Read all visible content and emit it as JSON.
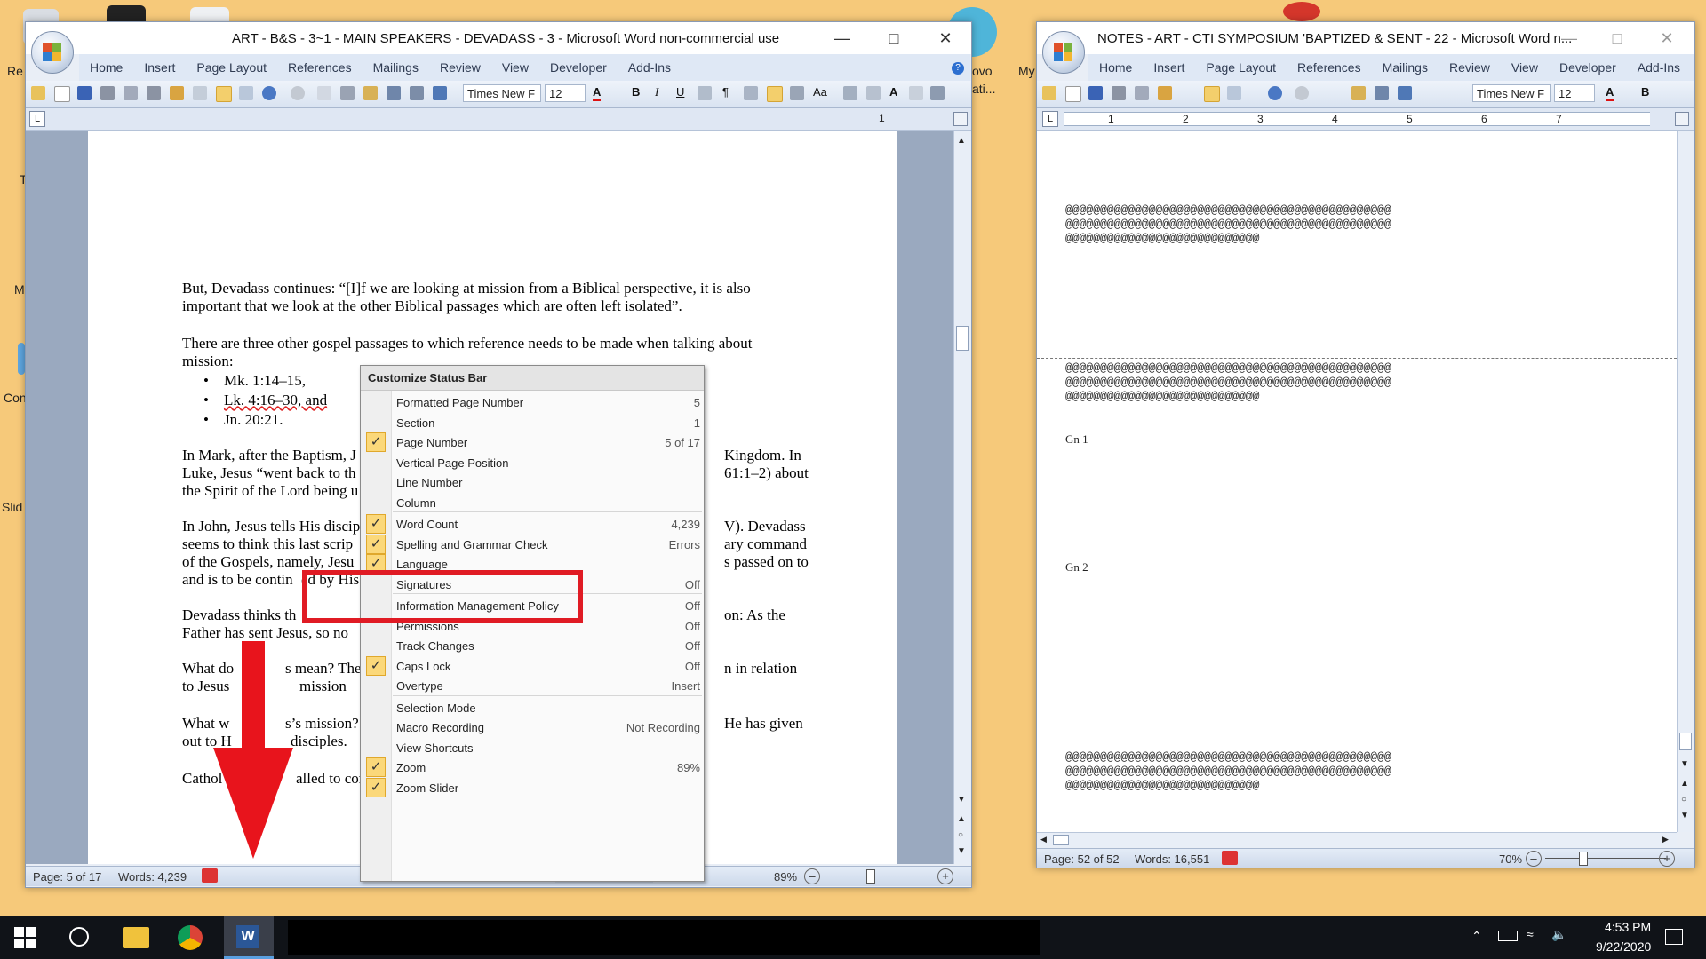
{
  "desktop": {
    "labels": [
      "Re",
      "My",
      "M",
      "Con",
      "Slid",
      "ovo",
      "ati...",
      "T"
    ]
  },
  "left_window": {
    "title": "ART - B&S - 3~1 - MAIN SPEAKERS - DEVADASS - 3 - Microsoft Word non-commercial use",
    "tabs": [
      "Home",
      "Insert",
      "Page Layout",
      "References",
      "Mailings",
      "Review",
      "View",
      "Developer",
      "Add-Ins"
    ],
    "font_name": "Times New F",
    "font_size": "12",
    "ruler_mark": "1",
    "body": {
      "p1": "But, Devadass continues: “[I]f we are looking at mission from a Biblical perspective, it is also important that we look at the other Biblical passages which are often left isolated”.",
      "p2": "There are three other gospel passages to which reference needs to be made when talking about mission:",
      "bullets": [
        "Mk. 1:14–15,",
        "Lk. 4:16–30, and",
        "Jn. 20:21."
      ],
      "p3a": "In Mark, after the Baptism, J",
      "p3b": "Kingdom.  In",
      "p3c": "Luke, Jesus “went back to th",
      "p3d": "61:1–2) about",
      "p3e": "the Spirit of the Lord being u",
      "p4a": "In John, Jesus tells His discip",
      "p4b": "V).  Devadass",
      "p4c": "seems to think this last scrip",
      "p4d": "ary command",
      "p4e": "of the Gospels, namely, Jesu",
      "p4f": "s passed on to",
      "p4g": "and is to be contin",
      "p4h": "ed by His",
      "p5a": "Devadass thinks th",
      "p5b": "on: As the",
      "p5c": "Father has sent Jesus, so no",
      "p6a": "What do",
      "p6b": "s mean?  The r",
      "p6c": "n in relation",
      "p6d": "to Jesus",
      "p6e": "mission",
      "p7a": "What w",
      "p7b": "s’s mission?",
      "p7c": "He has given",
      "p7d": "out to H",
      "p7e": "disciples.",
      "p8a": "Cathol",
      "p8b": "alled to contin"
    },
    "status": {
      "page": "Page: 5 of 17",
      "words": "Words: 4,239",
      "zoom": "89%"
    }
  },
  "context_menu": {
    "title": "Customize Status Bar",
    "items": [
      {
        "label": "Formatted Page Number",
        "value": "5",
        "checked": false
      },
      {
        "label": "Section",
        "value": "1",
        "checked": false
      },
      {
        "label": "Page Number",
        "value": "5 of 17",
        "checked": true
      },
      {
        "label": "Vertical Page Position",
        "value": "",
        "checked": false
      },
      {
        "label": "Line Number",
        "value": "",
        "checked": false
      },
      {
        "label": "Column",
        "value": "",
        "checked": false
      },
      {
        "label": "Word Count",
        "value": "4,239",
        "checked": true
      },
      {
        "label": "Spelling and Grammar Check",
        "value": "Errors",
        "checked": true
      },
      {
        "label": "Language",
        "value": "",
        "checked": true
      },
      {
        "label": "Signatures",
        "value": "Off",
        "checked": false
      },
      {
        "label": "Information Management Policy",
        "value": "Off",
        "checked": false
      },
      {
        "label": "Permissions",
        "value": "Off",
        "checked": false
      },
      {
        "label": "Track Changes",
        "value": "Off",
        "checked": false
      },
      {
        "label": "Caps Lock",
        "value": "Off",
        "checked": true
      },
      {
        "label": "Overtype",
        "value": "Insert",
        "checked": false
      },
      {
        "label": "Selection Mode",
        "value": "",
        "checked": false
      },
      {
        "label": "Macro Recording",
        "value": "Not Recording",
        "checked": false
      },
      {
        "label": "View Shortcuts",
        "value": "",
        "checked": false
      },
      {
        "label": "Zoom",
        "value": "89%",
        "checked": true
      },
      {
        "label": "Zoom Slider",
        "value": "",
        "checked": true
      }
    ]
  },
  "right_window": {
    "title": "NOTES - ART - CTI SYMPOSIUM 'BAPTIZED & SENT - 22 - Microsoft Word n...",
    "tabs": [
      "Home",
      "Insert",
      "Page Layout",
      "References",
      "Mailings",
      "Review",
      "View",
      "Developer",
      "Add-Ins"
    ],
    "font_name": "Times New F",
    "font_size": "12",
    "ruler_numbers": [
      "1",
      "2",
      "3",
      "4",
      "5",
      "6",
      "7"
    ],
    "at_line_full": "@@@@@@@@@@@@@@@@@@@@@@@@@@@@@@@@@@@@@@@@@@@@@@@",
    "at_line_short": "@@@@@@@@@@@@@@@@@@@@@@@@@@@@",
    "gn1": "Gn 1",
    "gn2": "Gn 2",
    "status": {
      "page": "Page: 52 of 52",
      "words": "Words: 16,551",
      "zoom": "70%"
    }
  },
  "taskbar": {
    "time": "4:53 PM",
    "date": "9/22/2020"
  },
  "colors": {
    "desktop": "#f6c97a",
    "highlight_box": "#e01b24",
    "arrow": "#e8141c",
    "menu_check": "#fbd87a"
  }
}
